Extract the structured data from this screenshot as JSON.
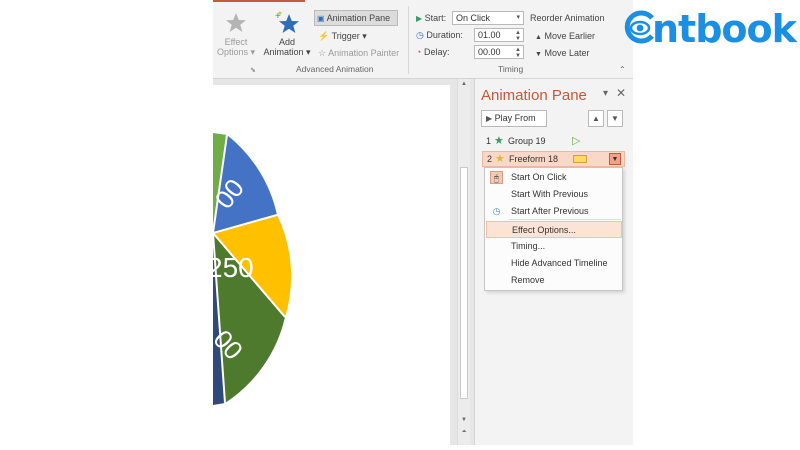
{
  "ribbon": {
    "effect_options": "Effect\nOptions",
    "effect_options_line1": "Effect",
    "effect_options_line2": "Options ▾",
    "add_animation_line1": "Add",
    "add_animation_line2": "Animation ▾",
    "animation_pane": "Animation Pane",
    "trigger": "Trigger ▾",
    "animation_painter": "Animation Painter",
    "group_label": "Advanced Animation",
    "start_label": "Start:",
    "start_value": "On Click",
    "duration_label": "Duration:",
    "duration_value": "01.00",
    "delay_label": "Delay:",
    "delay_value": "00.00",
    "reorder_label": "Reorder Animation",
    "move_earlier": "Move Earlier",
    "move_later": "Move Later",
    "timing_group_label": "Timing"
  },
  "slide": {
    "wheel_labels": [
      "00",
      "250",
      "00"
    ],
    "colors": {
      "blue": "#4472c4",
      "yellow": "#ffc000",
      "green": "#4e7a2d",
      "navy": "#2f4a7a",
      "lightgreen": "#70ad47"
    }
  },
  "pane": {
    "title": "Animation Pane",
    "play_from": "Play From",
    "items": [
      {
        "num": "1",
        "name": "Group 19",
        "star_color": "#3a9b6a"
      },
      {
        "num": "2",
        "name": "Freeform 18",
        "star_color": "#e7b33f"
      }
    ]
  },
  "menu": {
    "items": [
      {
        "label": "Start On Click",
        "icon": "mouse-click-icon"
      },
      {
        "label": "Start With Previous",
        "icon": ""
      },
      {
        "label": "Start After Previous",
        "icon": "clock-icon"
      },
      {
        "label": "Effect Options...",
        "icon": "",
        "highlighted": true
      },
      {
        "label": "Timing...",
        "icon": ""
      },
      {
        "label": "Hide Advanced Timeline",
        "icon": ""
      },
      {
        "label": "Remove",
        "icon": ""
      }
    ]
  },
  "logo": {
    "text": "ntbook",
    "color": "#1a8fe3"
  }
}
